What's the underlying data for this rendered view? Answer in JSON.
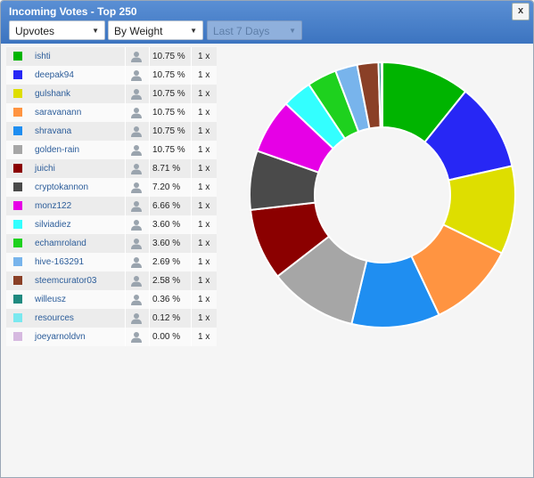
{
  "window": {
    "title": "Incoming Votes - Top 250",
    "close_label": "x"
  },
  "controls": {
    "vote_type": "Upvotes",
    "sort_by": "By Weight",
    "period": "Last 7 Days"
  },
  "voters": [
    {
      "name": "ishti",
      "percent": "10.75 %",
      "count": "1 x",
      "color": "#00b400"
    },
    {
      "name": "deepak94",
      "percent": "10.75 %",
      "count": "1 x",
      "color": "#2727f5"
    },
    {
      "name": "gulshank",
      "percent": "10.75 %",
      "count": "1 x",
      "color": "#dede00"
    },
    {
      "name": "saravanann",
      "percent": "10.75 %",
      "count": "1 x",
      "color": "#ff9441"
    },
    {
      "name": "shravana",
      "percent": "10.75 %",
      "count": "1 x",
      "color": "#1f8ef1"
    },
    {
      "name": "golden-rain",
      "percent": "10.75 %",
      "count": "1 x",
      "color": "#a6a6a6"
    },
    {
      "name": "juichi",
      "percent": "8.71 %",
      "count": "1 x",
      "color": "#8b0000"
    },
    {
      "name": "cryptokannon",
      "percent": "7.20 %",
      "count": "1 x",
      "color": "#4a4a4a"
    },
    {
      "name": "monz122",
      "percent": "6.66 %",
      "count": "1 x",
      "color": "#e600e6"
    },
    {
      "name": "silviadiez",
      "percent": "3.60 %",
      "count": "1 x",
      "color": "#33ffff"
    },
    {
      "name": "echamroland",
      "percent": "3.60 %",
      "count": "1 x",
      "color": "#1ed11e"
    },
    {
      "name": "hive-163291",
      "percent": "2.69 %",
      "count": "1 x",
      "color": "#78b4ec"
    },
    {
      "name": "steemcurator03",
      "percent": "2.58 %",
      "count": "1 x",
      "color": "#8a4027"
    },
    {
      "name": "willeusz",
      "percent": "0.36 %",
      "count": "1 x",
      "color": "#1f8a80"
    },
    {
      "name": "resources",
      "percent": "0.12 %",
      "count": "1 x",
      "color": "#7ae8ef"
    },
    {
      "name": "joeyarnoldvn",
      "percent": "0.00 %",
      "count": "1 x",
      "color": "#d6b9e0"
    }
  ],
  "chart_data": {
    "type": "pie",
    "style": "donut",
    "categories": [
      "ishti",
      "deepak94",
      "gulshank",
      "saravanann",
      "shravana",
      "golden-rain",
      "juichi",
      "cryptokannon",
      "monz122",
      "silviadiez",
      "echamroland",
      "hive-163291",
      "steemcurator03",
      "willeusz",
      "resources",
      "joeyarnoldvn"
    ],
    "values": [
      10.75,
      10.75,
      10.75,
      10.75,
      10.75,
      10.75,
      8.71,
      7.2,
      6.66,
      3.6,
      3.6,
      2.69,
      2.58,
      0.36,
      0.12,
      0.0
    ],
    "colors": [
      "#00b400",
      "#2727f5",
      "#dede00",
      "#ff9441",
      "#1f8ef1",
      "#a6a6a6",
      "#8b0000",
      "#4a4a4a",
      "#e600e6",
      "#33ffff",
      "#1ed11e",
      "#78b4ec",
      "#8a4027",
      "#1f8a80",
      "#7ae8ef",
      "#d6b9e0"
    ]
  }
}
